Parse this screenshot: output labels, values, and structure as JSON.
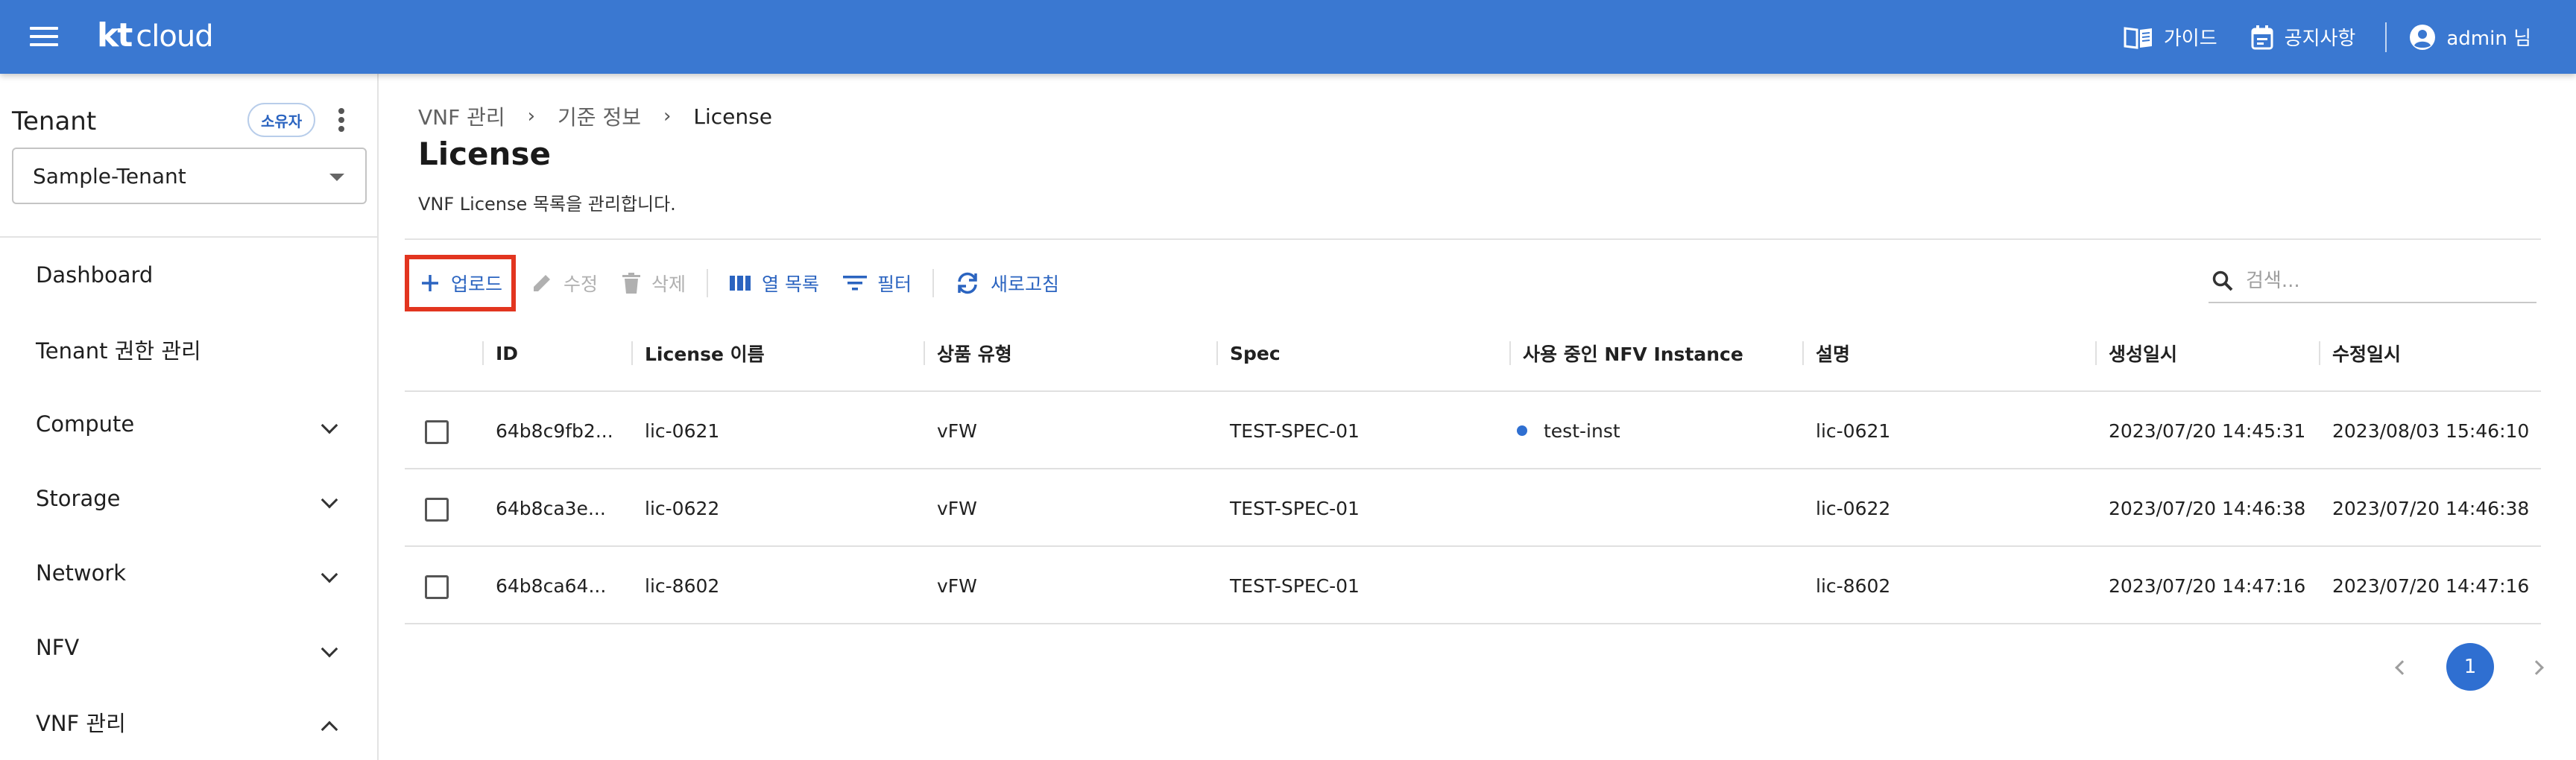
{
  "header": {
    "logo_kt": "kt",
    "logo_cloud": "cloud",
    "guide_label": "가이드",
    "notice_label": "공지사항",
    "user_label": "admin 님",
    "brand_color": "#3a78d1"
  },
  "sidebar": {
    "tenant_title": "Tenant",
    "owner_badge": "소유자",
    "tenant_selected": "Sample-Tenant",
    "items": [
      {
        "label": "Dashboard",
        "expandable": false
      },
      {
        "label": "Tenant 권한 관리",
        "expandable": false
      },
      {
        "label": "Compute",
        "expandable": true,
        "expanded": false
      },
      {
        "label": "Storage",
        "expandable": true,
        "expanded": false
      },
      {
        "label": "Network",
        "expandable": true,
        "expanded": false
      },
      {
        "label": "NFV",
        "expandable": true,
        "expanded": false
      },
      {
        "label": "VNF 관리",
        "expandable": true,
        "expanded": true
      }
    ]
  },
  "breadcrumb": [
    "VNF 관리",
    "기준 정보",
    "License"
  ],
  "page": {
    "title": "License",
    "description": "VNF License 목록을 관리합니다."
  },
  "toolbar": {
    "upload_label": "업로드",
    "edit_label": "수정",
    "delete_label": "삭제",
    "columns_label": "열 목록",
    "filter_label": "필터",
    "refresh_label": "새로고침",
    "highlight_color": "#e2351f"
  },
  "search": {
    "placeholder": "검색...",
    "value": ""
  },
  "table": {
    "columns": [
      "ID",
      "License 이름",
      "상품 유형",
      "Spec",
      "사용 중인 NFV Instance",
      "설명",
      "생성일시",
      "수정일시"
    ],
    "rows": [
      {
        "id": "64b8c9fb2...",
        "name": "lic-0621",
        "type": "vFW",
        "spec": "TEST-SPEC-01",
        "instance": "test-inst",
        "desc": "lic-0621",
        "created": "2023/07/20 14:45:31",
        "updated": "2023/08/03 15:46:10"
      },
      {
        "id": "64b8ca3e...",
        "name": "lic-0622",
        "type": "vFW",
        "spec": "TEST-SPEC-01",
        "instance": "",
        "desc": "lic-0622",
        "created": "2023/07/20 14:46:38",
        "updated": "2023/07/20 14:46:38"
      },
      {
        "id": "64b8ca64...",
        "name": "lic-8602",
        "type": "vFW",
        "spec": "TEST-SPEC-01",
        "instance": "",
        "desc": "lic-8602",
        "created": "2023/07/20 14:47:16",
        "updated": "2023/07/20 14:47:16"
      }
    ],
    "status_dot_color": "#2f6fd1"
  },
  "pagination": {
    "current_page": "1"
  }
}
